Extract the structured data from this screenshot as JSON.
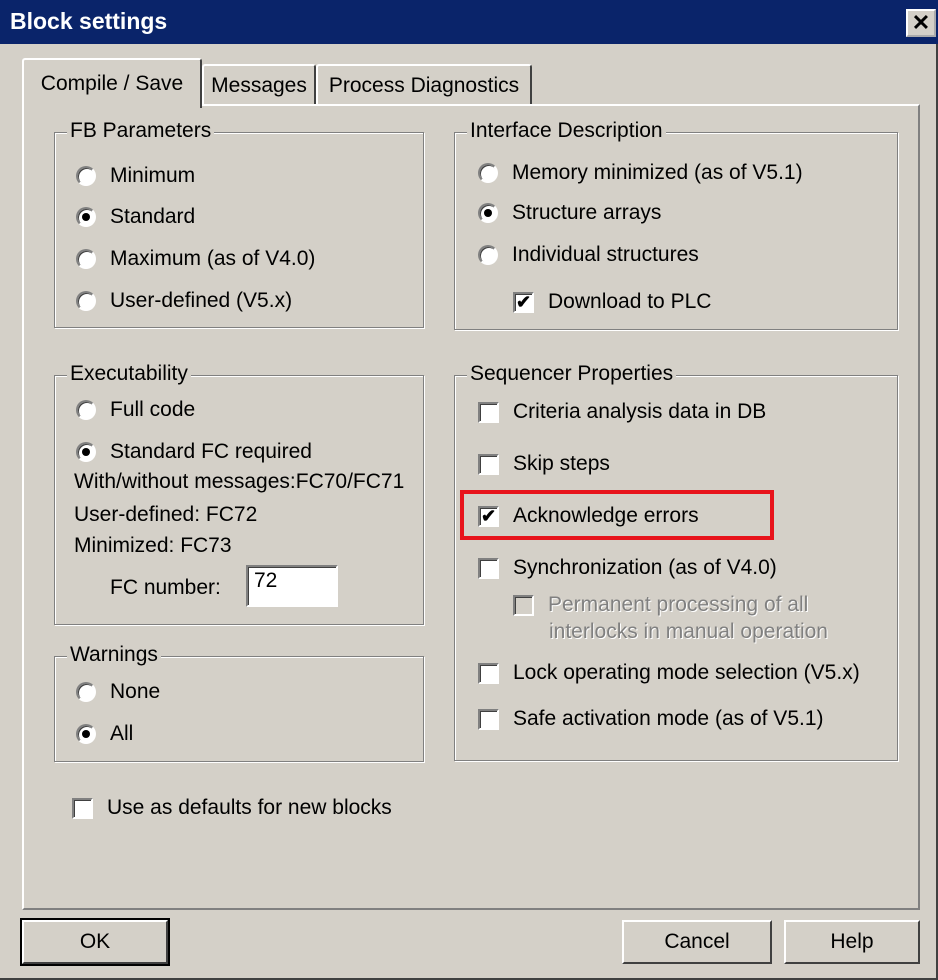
{
  "window": {
    "title": "Block settings",
    "close_glyph": "✕"
  },
  "tabs": [
    {
      "label": "Compile / Save",
      "active": true
    },
    {
      "label": "Messages",
      "active": false
    },
    {
      "label": "Process Diagnostics",
      "active": false
    }
  ],
  "fb_parameters": {
    "title": "FB Parameters",
    "options": [
      {
        "label": "Minimum",
        "selected": false
      },
      {
        "label": "Standard",
        "selected": true
      },
      {
        "label": "Maximum (as of V4.0)",
        "selected": false
      },
      {
        "label": "User-defined (V5.x)",
        "selected": false
      }
    ]
  },
  "interface_description": {
    "title": "Interface Description",
    "options": [
      {
        "label": "Memory minimized (as of V5.1)",
        "selected": false
      },
      {
        "label": "Structure arrays",
        "selected": true
      },
      {
        "label": "Individual structures",
        "selected": false
      }
    ],
    "download_to_plc": {
      "label": "Download to PLC",
      "checked": true
    }
  },
  "executability": {
    "title": "Executability",
    "options": [
      {
        "label": "Full code",
        "selected": false
      },
      {
        "label": "Standard FC required",
        "selected": true
      }
    ],
    "info_lines": [
      "With/without messages:FC70/FC71",
      "User-defined: FC72",
      "Minimized: FC73"
    ],
    "fc_number_label": "FC number:",
    "fc_number_value": "72"
  },
  "sequencer_properties": {
    "title": "Sequencer Properties",
    "items": [
      {
        "label": "Criteria analysis data in DB",
        "checked": false
      },
      {
        "label": "Skip steps",
        "checked": false
      },
      {
        "label": "Acknowledge errors",
        "checked": true
      },
      {
        "label": "Synchronization (as of V4.0)",
        "checked": false
      },
      {
        "label": "Permanent processing of all",
        "label2": "interlocks in manual operation",
        "checked": false,
        "disabled": true
      },
      {
        "label": "Lock operating mode selection (V5.x)",
        "checked": false
      },
      {
        "label": "Safe activation mode (as of V5.1)",
        "checked": false
      }
    ]
  },
  "warnings": {
    "title": "Warnings",
    "options": [
      {
        "label": "None",
        "selected": false
      },
      {
        "label": "All",
        "selected": true
      }
    ]
  },
  "defaults": {
    "label": "Use as defaults for new blocks",
    "checked": false
  },
  "buttons": {
    "ok": "OK",
    "cancel": "Cancel",
    "help": "Help"
  },
  "colors": {
    "highlight": "#e8141c",
    "titlebar": "#0a246a",
    "face": "#d4d0c8"
  }
}
